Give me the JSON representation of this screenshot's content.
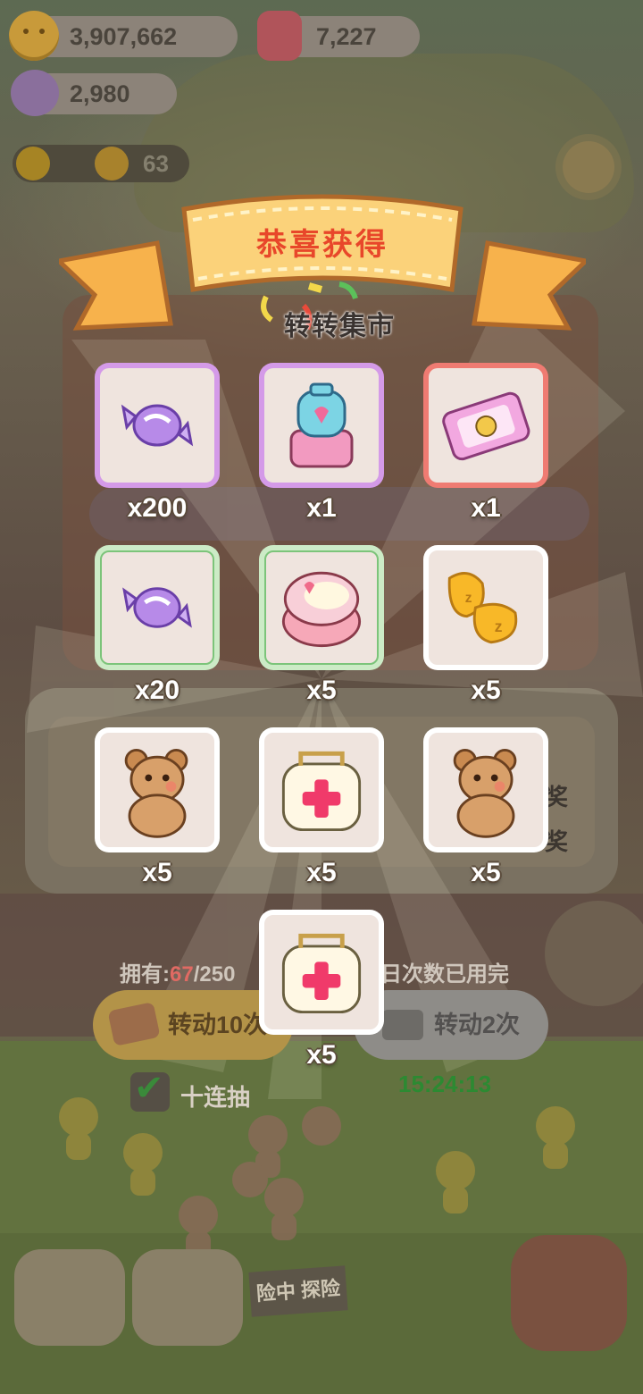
{
  "currencies": {
    "coins": "3,907,662",
    "gems": "7,227",
    "candies": "2,980",
    "sun_count": "63"
  },
  "popup": {
    "title": "恭喜获得",
    "market_name": "转转集市"
  },
  "rewards": [
    {
      "item": "candy",
      "quantity": "x200",
      "rarity_color": "#d49ae8"
    },
    {
      "item": "perfume-bottle",
      "quantity": "x1",
      "rarity_color": "#d49ae8"
    },
    {
      "item": "ticket",
      "quantity": "x1",
      "rarity_color": "#ef7b72"
    },
    {
      "item": "candy",
      "quantity": "x20",
      "rarity_color": "#7cc47a"
    },
    {
      "item": "cake",
      "quantity": "x5",
      "rarity_color": "#7cc47a"
    },
    {
      "item": "slippers",
      "quantity": "x5",
      "rarity_color": "#ffffff"
    },
    {
      "item": "teddy-bear",
      "quantity": "x5",
      "rarity_color": "#ffffff"
    },
    {
      "item": "first-aid-kit",
      "quantity": "x5",
      "rarity_color": "#ffffff"
    },
    {
      "item": "teddy-bear",
      "quantity": "x5",
      "rarity_color": "#ffffff"
    },
    {
      "item": "first-aid-kit",
      "quantity": "x5",
      "rarity_color": "#ffffff"
    }
  ],
  "spin_panel": {
    "owned_label": "拥有:",
    "owned_value": "67",
    "owned_total": "/250",
    "daily_used": "日次数已用完",
    "spin10_label": "转动10次",
    "spin2_label": "转动2次",
    "timer": "15:24:13",
    "ten_draw_label": "十连抽"
  },
  "side_text": [
    "奖",
    "奖"
  ],
  "nav": {
    "explore_sign": "险中 探险"
  }
}
